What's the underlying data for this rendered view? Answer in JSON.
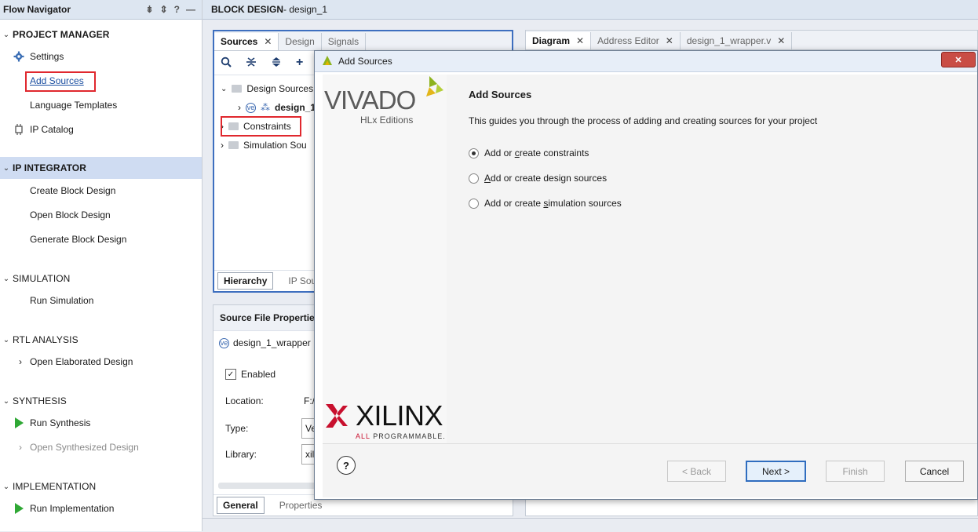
{
  "flow_navigator": {
    "title": "Flow Navigator",
    "sections": [
      {
        "label": "PROJECT MANAGER",
        "items": [
          "Settings",
          "Add Sources",
          "Language Templates",
          "IP Catalog"
        ]
      },
      {
        "label": "IP INTEGRATOR",
        "items": [
          "Create Block Design",
          "Open Block Design",
          "Generate Block Design"
        ]
      },
      {
        "label": "SIMULATION",
        "items": [
          "Run Simulation"
        ]
      },
      {
        "label": "RTL ANALYSIS",
        "items": [
          "Open Elaborated Design"
        ]
      },
      {
        "label": "SYNTHESIS",
        "items": [
          "Run Synthesis",
          "Open Synthesized Design"
        ]
      },
      {
        "label": "IMPLEMENTATION",
        "items": [
          "Run Implementation"
        ]
      }
    ]
  },
  "block_design": {
    "title_prefix": "BLOCK DESIGN",
    "title_name": " - design_1"
  },
  "sources_panel": {
    "tabs": [
      "Sources",
      "Design",
      "Signals"
    ],
    "tree": [
      "Design Sources",
      "design_1_",
      "Constraints",
      "Simulation Sou"
    ],
    "bottom_tabs": [
      "Hierarchy",
      "IP Sour"
    ]
  },
  "source_file_properties": {
    "title": "Source File Properties",
    "file": "design_1_wrapper",
    "enabled": "Enabled",
    "location_label": "Location:",
    "location_value": "F:/",
    "type_label": "Type:",
    "type_value": "Ve",
    "library_label": "Library:",
    "library_value": "xil_",
    "bottom_tabs": [
      "General",
      "Properties"
    ]
  },
  "diagram_tabs": [
    "Diagram",
    "Address Editor",
    "design_1_wrapper.v"
  ],
  "dialog": {
    "title": "Add Sources",
    "brand_top": "VIVADO",
    "brand_sub": "HLx Editions",
    "brand_bottom": "XILINX",
    "brand_tagline_a": "ALL",
    "brand_tagline_b": " PROGRAMMABLE.",
    "heading": "Add Sources",
    "description": "This guides you through the process of adding and creating sources for your project",
    "options": [
      {
        "pre": "Add or ",
        "key": "c",
        "post": "reate constraints",
        "selected": true
      },
      {
        "pre": "",
        "key": "A",
        "post": "dd or create design sources",
        "selected": false
      },
      {
        "pre": "Add or create ",
        "key": "s",
        "post": "imulation sources",
        "selected": false
      }
    ],
    "help": "?",
    "buttons": {
      "back": "< Back",
      "next": "Next >",
      "finish": "Finish",
      "cancel": "Cancel"
    }
  },
  "colors": {
    "accent": "#2f6dbf",
    "highlight": "#e0282e",
    "xilinx_red": "#c8102e",
    "vivado_green": "#8db31e"
  }
}
